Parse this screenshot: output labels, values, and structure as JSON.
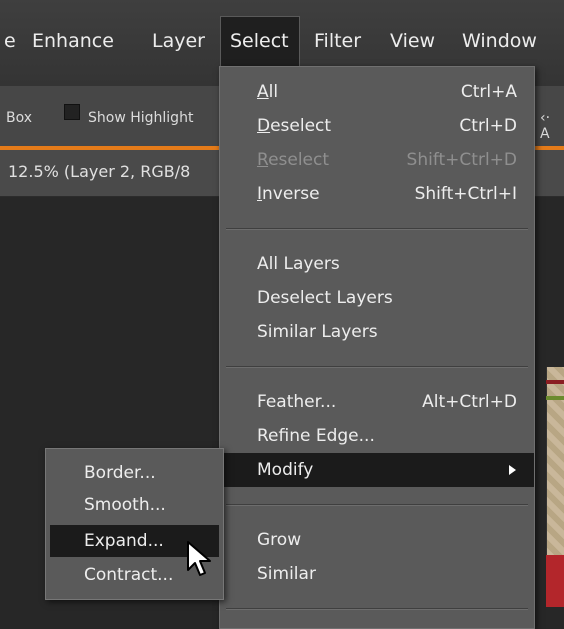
{
  "menubar": {
    "items": [
      {
        "id": "e",
        "label": "e"
      },
      {
        "id": "enhance",
        "label": "Enhance"
      },
      {
        "id": "layer",
        "label": "Layer"
      },
      {
        "id": "select",
        "label": "Select"
      },
      {
        "id": "filter",
        "label": "Filter"
      },
      {
        "id": "view",
        "label": "View"
      },
      {
        "id": "window",
        "label": "Window"
      }
    ]
  },
  "options_bar": {
    "box_label": "Box",
    "show_highlight_label": "Show Highlight",
    "right_fragment": "‹· A"
  },
  "document": {
    "tab_title": "12.5% (Layer 2, RGB/8"
  },
  "select_menu": {
    "groups": [
      [
        {
          "label": "All",
          "shortcut": "Ctrl+A",
          "mnemonic": "A",
          "enabled": true
        },
        {
          "label": "Deselect",
          "shortcut": "Ctrl+D",
          "mnemonic": "D",
          "enabled": true
        },
        {
          "label": "Reselect",
          "shortcut": "Shift+Ctrl+D",
          "mnemonic": "R",
          "enabled": false
        },
        {
          "label": "Inverse",
          "shortcut": "Shift+Ctrl+I",
          "mnemonic": "I",
          "enabled": true
        }
      ],
      [
        {
          "label": "All Layers",
          "shortcut": "",
          "enabled": true
        },
        {
          "label": "Deselect Layers",
          "shortcut": "",
          "enabled": true
        },
        {
          "label": "Similar Layers",
          "shortcut": "",
          "enabled": true
        }
      ],
      [
        {
          "label": "Feather...",
          "shortcut": "Alt+Ctrl+D",
          "enabled": true
        },
        {
          "label": "Refine Edge...",
          "shortcut": "",
          "enabled": true
        },
        {
          "label": "Modify",
          "shortcut": "",
          "enabled": true,
          "has_submenu": true,
          "active": true
        }
      ],
      [
        {
          "label": "Grow",
          "shortcut": "",
          "enabled": true
        },
        {
          "label": "Similar",
          "shortcut": "",
          "enabled": true
        }
      ]
    ]
  },
  "modify_submenu": {
    "items": [
      {
        "label": "Border...",
        "active": false
      },
      {
        "label": "Smooth...",
        "active": false
      },
      {
        "label": "Expand...",
        "active": true
      },
      {
        "label": "Contract...",
        "active": false
      }
    ]
  },
  "colors": {
    "accent_orange": "#e57b19",
    "menu_bg": "#5a5a5a",
    "highlight_bg": "#1b1b1b",
    "disabled_text": "#8f8f8f"
  },
  "icons": {
    "submenu_arrow": "chevron-right-icon",
    "cursor": "mouse-pointer-icon"
  }
}
